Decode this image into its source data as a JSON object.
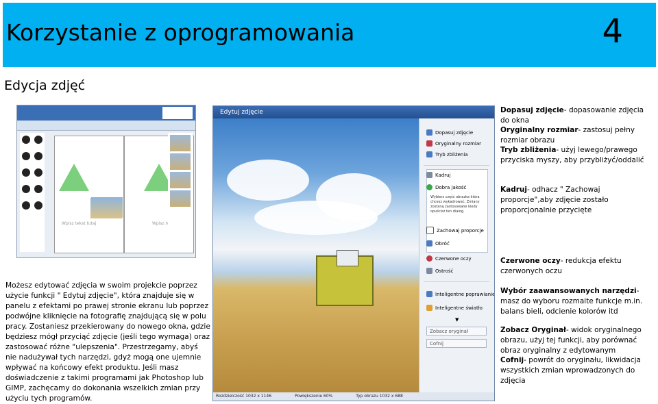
{
  "header": {
    "title": "Korzystanie z oprogramowania",
    "page_number": "4",
    "bg_color": "#00b0f0"
  },
  "subtitle": "Edycja zdjęć",
  "left_screenshot": {
    "caption1": "Wpisz tekst tutaj",
    "caption2": "Wpisz tekst tutaj"
  },
  "editor": {
    "title": "Edytuj zdjęcie",
    "buttons": {
      "fit": "Dopasuj zdjęcie",
      "original_size": "Oryginalny rozmiar",
      "zoom": "Tryb zbliżenia",
      "crop": "Kadruj",
      "quality": "Dobra jakość",
      "crop_hint": "Wybierz część obrazka która chcesz wykadrować. Zmiany zostaną zastosowane kiedy opuścisz ten dialog.",
      "keep_ratio": "Zachowaj proporcje",
      "rotate": "Obróć",
      "redeye": "Czerwone oczy",
      "sharpen": "Ostrość",
      "smart_fix": "Inteligentne poprawianie",
      "smart_light": "Inteligentne światło",
      "show_original": "Zobacz oryginał",
      "undo": "Cofnij"
    },
    "status": {
      "size": "Rozdzielczość 1032 x 1146",
      "zoom": "Powiększenie 60%",
      "type": "Typ obrazu 1032 x 688"
    }
  },
  "descriptions": {
    "fit_label": "Dopasuj zdjęcie",
    "fit_text": "- dopasowanie zdjęcia do okna",
    "orig_label": "Oryginalny rozmiar",
    "orig_text": "- zastosuj pełny rozmiar obrazu",
    "zoom_label": "Tryb zbliżenia",
    "zoom_text": "- użyj lewego/prawego przyciska myszy, aby przybliżyć/oddalić",
    "crop_label": "Kadruj",
    "crop_text": "- odhacz \" Zachowaj proporcje\",aby zdjęcie zostało proporcjonalnie przycięte",
    "redeye_label": "Czerwone oczy",
    "redeye_text": "- redukcja efektu czerwonych oczu",
    "tools_label": "Wybór zaawansowanych narzędzi",
    "tools_text": "- masz do wyboru rozmaite funkcje m.in. balans bieli, odcienie kolorów itd",
    "orig2_label": "Zobacz Oryginał",
    "orig2_text": "- widok oryginalnego obrazu, użyj tej funkcji, aby porównać obraz oryginalny z edytowanym",
    "undo_label": "Cofnij",
    "undo_text": "- powrót do oryginału, likwidacja wszystkich zmian wprowadzonych do zdjęcia"
  },
  "left_text": "Możesz edytować zdjęcia w swoim projekcie poprzez użycie funkcji \" Edytuj zdjęcie\", która znajduje się w panelu z efektami po prawej stronie ekranu lub poprzez podwójne kliknięcie na fotografię znajdującą się w polu pracy. Zostaniesz przekierowany do nowego okna, gdzie będziesz mógł przyciąć zdjęcie (jeśli tego wymaga) oraz zastosować różne \"ulepszenia\". Przestrzegamy, abyś nie nadużywał tych narzędzi, gdyż mogą one ujemnie wpływać na końcowy efekt produktu. Jeśli masz doświadczenie z takimi programami jak Photoshop lub GIMP, zachęcamy do dokonania wszelkich zmian przy użyciu tych programów."
}
